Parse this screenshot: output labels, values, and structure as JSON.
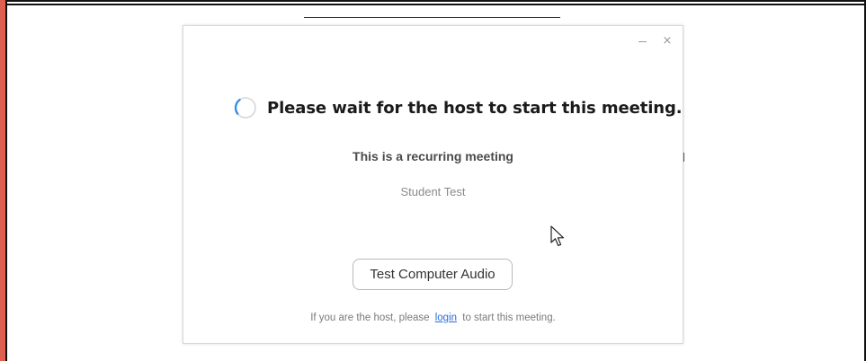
{
  "dialog": {
    "window_controls": {
      "minimize_icon": "minimize-icon",
      "close_icon": "close-icon",
      "close_glyph": "×"
    },
    "status_icon": "loading-spinner-icon",
    "wait_message": "Please wait for the host to start this meeting.",
    "recurring_note": "This is a recurring meeting",
    "meeting_topic": "Student Test",
    "test_audio_label": "Test Computer Audio",
    "host_prompt": {
      "before": "If you are the host, please",
      "link": "login",
      "after": "to start this meeting."
    }
  },
  "colors": {
    "link": "#2a6fd6",
    "spinner_accent": "#3b8fe0",
    "left_edge": "#e06050"
  }
}
